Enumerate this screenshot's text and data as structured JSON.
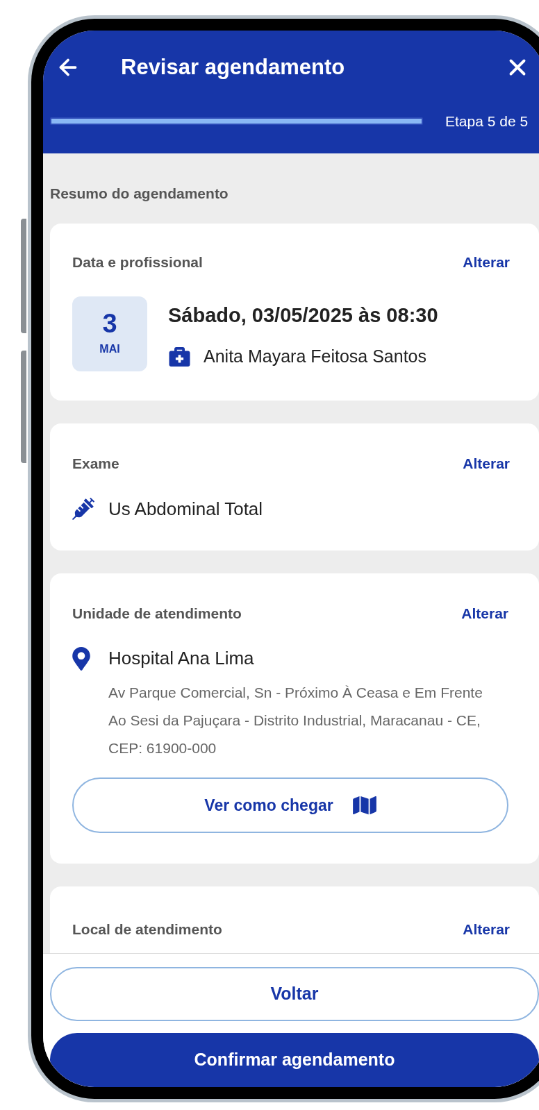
{
  "header": {
    "title": "Revisar agendamento",
    "step_label": "Etapa 5 de 5",
    "level": 1
  },
  "section_title": "Resumo do agendamento",
  "cards": [
    {
      "kind": "appointment",
      "title": "Data e profissional",
      "action": "Alterar",
      "day": "3",
      "month": "MAI",
      "datetime": "Sábado, 03/05/2025 às 08:30",
      "professional": "Anita Mayara Feitosa Santos"
    },
    {
      "kind": "exam",
      "title": "Exame",
      "action": "Alterar",
      "name": "Us Abdominal Total"
    },
    {
      "kind": "unit",
      "title": "Unidade de atendimento",
      "action": "Alterar",
      "name": "Hospital Ana Lima",
      "address": "Av Parque Comercial, Sn - Próximo À Ceasa e Em Frente Ao Sesi da Pajuçara - Distrito Industrial, Maracanau - CE, CEP: 61900-000",
      "button": "Ver como chegar"
    },
    {
      "kind": "location",
      "title": "Local de atendimento",
      "action": "Alterar"
    }
  ],
  "footer": [
    {
      "kind": "secondary",
      "label": "Voltar"
    },
    {
      "kind": "primary",
      "label": "Confirmar agendamento"
    }
  ]
}
